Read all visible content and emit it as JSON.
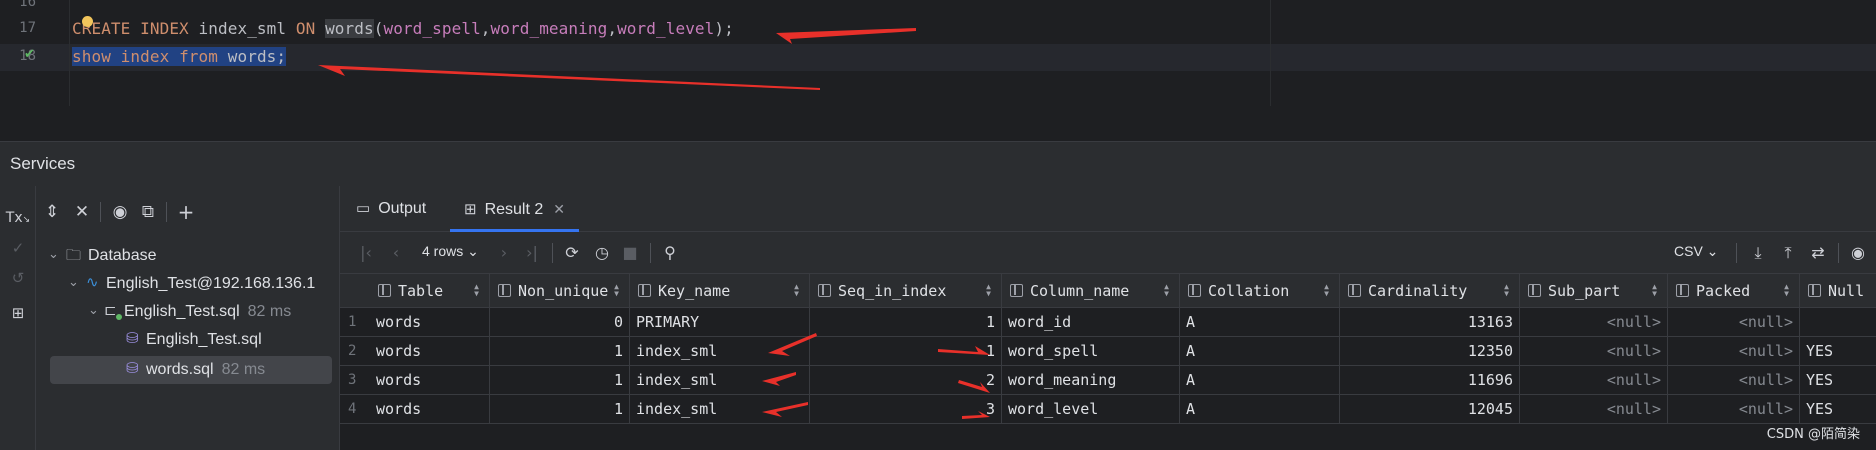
{
  "editor": {
    "line_numbers": [
      "16",
      "17",
      "18"
    ],
    "line17": {
      "kw1": "CREATE INDEX",
      "index_name": " index_sml ",
      "kw2": "ON",
      "table": "words",
      "open": "(",
      "c1": "word_spell",
      "comma1": ",",
      "c2": "word_meaning",
      "comma2": ",",
      "c3": "word_level",
      "close": ");"
    },
    "line18": {
      "kw1": "show",
      "kw2": "index",
      "kw3": "from",
      "table": "words",
      "semi": ";"
    }
  },
  "services": {
    "title": "Services"
  },
  "left_strip": {
    "items": [
      "tx-icon",
      "check-icon",
      "undo-icon",
      "layout-icon"
    ],
    "tx_label": "Tx"
  },
  "tree_toolbar": {
    "icons": [
      "expand-all-icon",
      "collapse-all-icon",
      "eye-icon",
      "new-tab-icon",
      "add-icon"
    ]
  },
  "tree": {
    "items": [
      {
        "label": "Database",
        "meta": ""
      },
      {
        "label": "English_Test@192.168.136.1",
        "meta": ""
      },
      {
        "label": "English_Test.sql",
        "meta": "82 ms"
      },
      {
        "label": "English_Test.sql",
        "meta": ""
      },
      {
        "label": "words.sql",
        "meta": "82 ms"
      }
    ]
  },
  "tabs": [
    {
      "label": "Output"
    },
    {
      "label": "Result 2"
    }
  ],
  "result_toolbar": {
    "rows_label": "4 rows",
    "export_format": "CSV"
  },
  "table": {
    "headers": [
      "Table",
      "Non_unique",
      "Key_name",
      "Seq_in_index",
      "Column_name",
      "Collation",
      "Cardinality",
      "Sub_part",
      "Packed",
      "Null"
    ],
    "rows": [
      {
        "n": "1",
        "cells": [
          "words",
          "0",
          "PRIMARY",
          "1",
          "word_id",
          "A",
          "13163",
          "<null>",
          "<null>",
          ""
        ]
      },
      {
        "n": "2",
        "cells": [
          "words",
          "1",
          "index_sml",
          "1",
          "word_spell",
          "A",
          "12350",
          "<null>",
          "<null>",
          "YES"
        ]
      },
      {
        "n": "3",
        "cells": [
          "words",
          "1",
          "index_sml",
          "2",
          "word_meaning",
          "A",
          "11696",
          "<null>",
          "<null>",
          "YES"
        ]
      },
      {
        "n": "4",
        "cells": [
          "words",
          "1",
          "index_sml",
          "3",
          "word_level",
          "A",
          "12045",
          "<null>",
          "<null>",
          "YES"
        ]
      }
    ]
  },
  "watermark": "CSDN @陌简染",
  "colors": {
    "accent": "#3574f0",
    "annotation_arrow": "#e8302a",
    "keyword": "#cf8e6d",
    "column": "#c77dbb",
    "selection": "#214283"
  }
}
